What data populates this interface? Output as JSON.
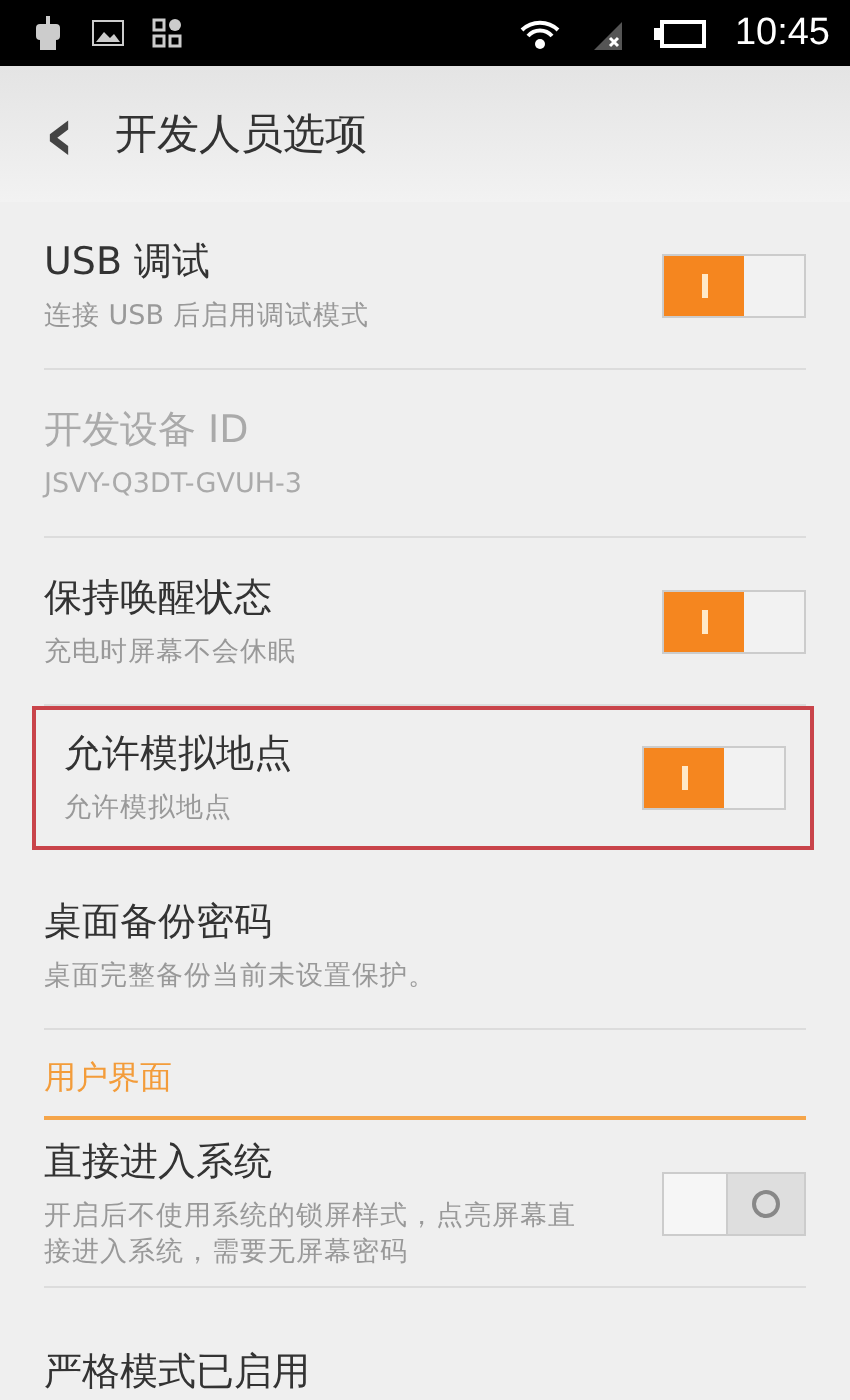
{
  "status_bar": {
    "time": "10:45"
  },
  "header": {
    "back": "‹",
    "title": "开发人员选项"
  },
  "items": [
    {
      "kind": "toggle",
      "title": "USB 调试",
      "subtitle": "连接 USB 后启用调试模式",
      "on": true,
      "disabled": false,
      "highlighted": false
    },
    {
      "kind": "info",
      "title": "开发设备 ID",
      "subtitle": "JSVY-Q3DT-GVUH-3",
      "disabled": true,
      "highlighted": false
    },
    {
      "kind": "toggle",
      "title": "保持唤醒状态",
      "subtitle": "充电时屏幕不会休眠",
      "on": true,
      "disabled": false,
      "highlighted": false
    },
    {
      "kind": "toggle",
      "title": "允许模拟地点",
      "subtitle": "允许模拟地点",
      "on": true,
      "disabled": false,
      "highlighted": true
    },
    {
      "kind": "info",
      "title": "桌面备份密码",
      "subtitle": "桌面完整备份当前未设置保护。",
      "disabled": false,
      "highlighted": false
    },
    {
      "kind": "section",
      "title": "用户界面"
    },
    {
      "kind": "toggle",
      "title": "直接进入系统",
      "subtitle": "开启后不使用系统的锁屏样式，点亮屏幕直接进入系统，需要无屏幕密码",
      "on": false,
      "disabled": false,
      "highlighted": false
    },
    {
      "kind": "info",
      "title": "严格模式已启用",
      "disabled": false,
      "highlighted": false
    }
  ]
}
